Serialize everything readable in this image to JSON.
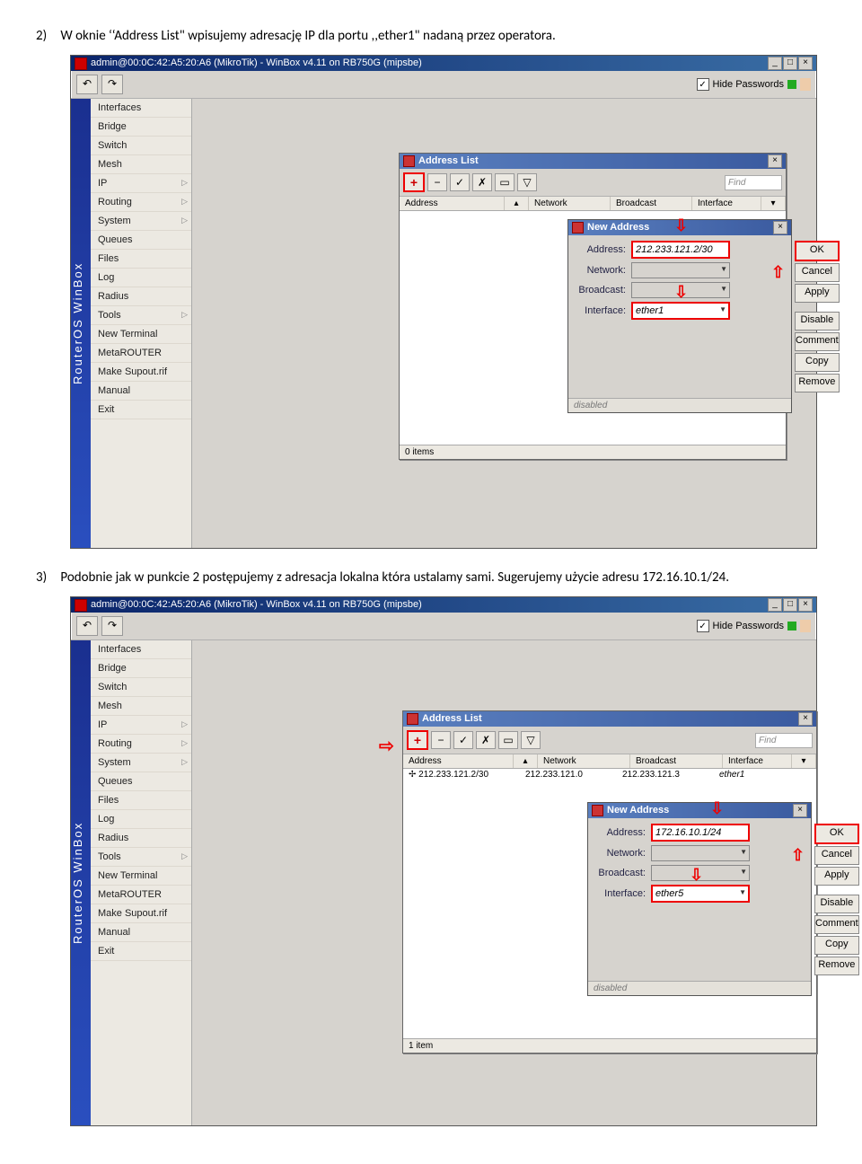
{
  "instructions": {
    "i2": "W oknie ‘‘Address List\" wpisujemy adresację IP dla portu ,,ether1\" nadaną przez operatora.",
    "i3a": "Podobnie jak w punkcie 2 postępujemy z adresacja lokalna która ustalamy sami. Sugerujemy użycie adresu 172.16.10.1/24.",
    "n2": "2)",
    "n3": "3)"
  },
  "app": {
    "title": "admin@00:0C:42:A5:20:A6 (MikroTik) - WinBox v4.11 on RB750G (mipsbe)",
    "hide_passwords": "Hide Passwords",
    "rail": "RouterOS WinBox"
  },
  "menu": [
    "Interfaces",
    "Bridge",
    "Switch",
    "Mesh",
    "IP",
    "Routing",
    "System",
    "Queues",
    "Files",
    "Log",
    "Radius",
    "Tools",
    "New Terminal",
    "MetaROUTER",
    "Make Supout.rif",
    "Manual",
    "Exit"
  ],
  "menu_arrows": [
    4,
    5,
    6,
    11
  ],
  "addresslist": {
    "title": "Address List",
    "find": "Find",
    "cols": {
      "addr": "Address",
      "net": "Network",
      "bcast": "Broadcast",
      "iface": "Interface"
    },
    "status0": "0 items",
    "status1": "1 item",
    "row1": {
      "addr": "212.233.121.2/30",
      "net": "212.233.121.0",
      "bcast": "212.233.121.3",
      "iface": "ether1"
    }
  },
  "newaddr": {
    "title": "New Address",
    "lbl_addr": "Address:",
    "lbl_net": "Network:",
    "lbl_bcast": "Broadcast:",
    "lbl_iface": "Interface:",
    "btn_ok": "OK",
    "btn_cancel": "Cancel",
    "btn_apply": "Apply",
    "btn_disable": "Disable",
    "btn_comment": "Comment",
    "btn_copy": "Copy",
    "btn_remove": "Remove",
    "disabled": "disabled"
  },
  "dlg1": {
    "addr": "212.233.121.2/30",
    "iface": "ether1"
  },
  "dlg2": {
    "addr": "172.16.10.1/24",
    "iface": "ether5"
  }
}
